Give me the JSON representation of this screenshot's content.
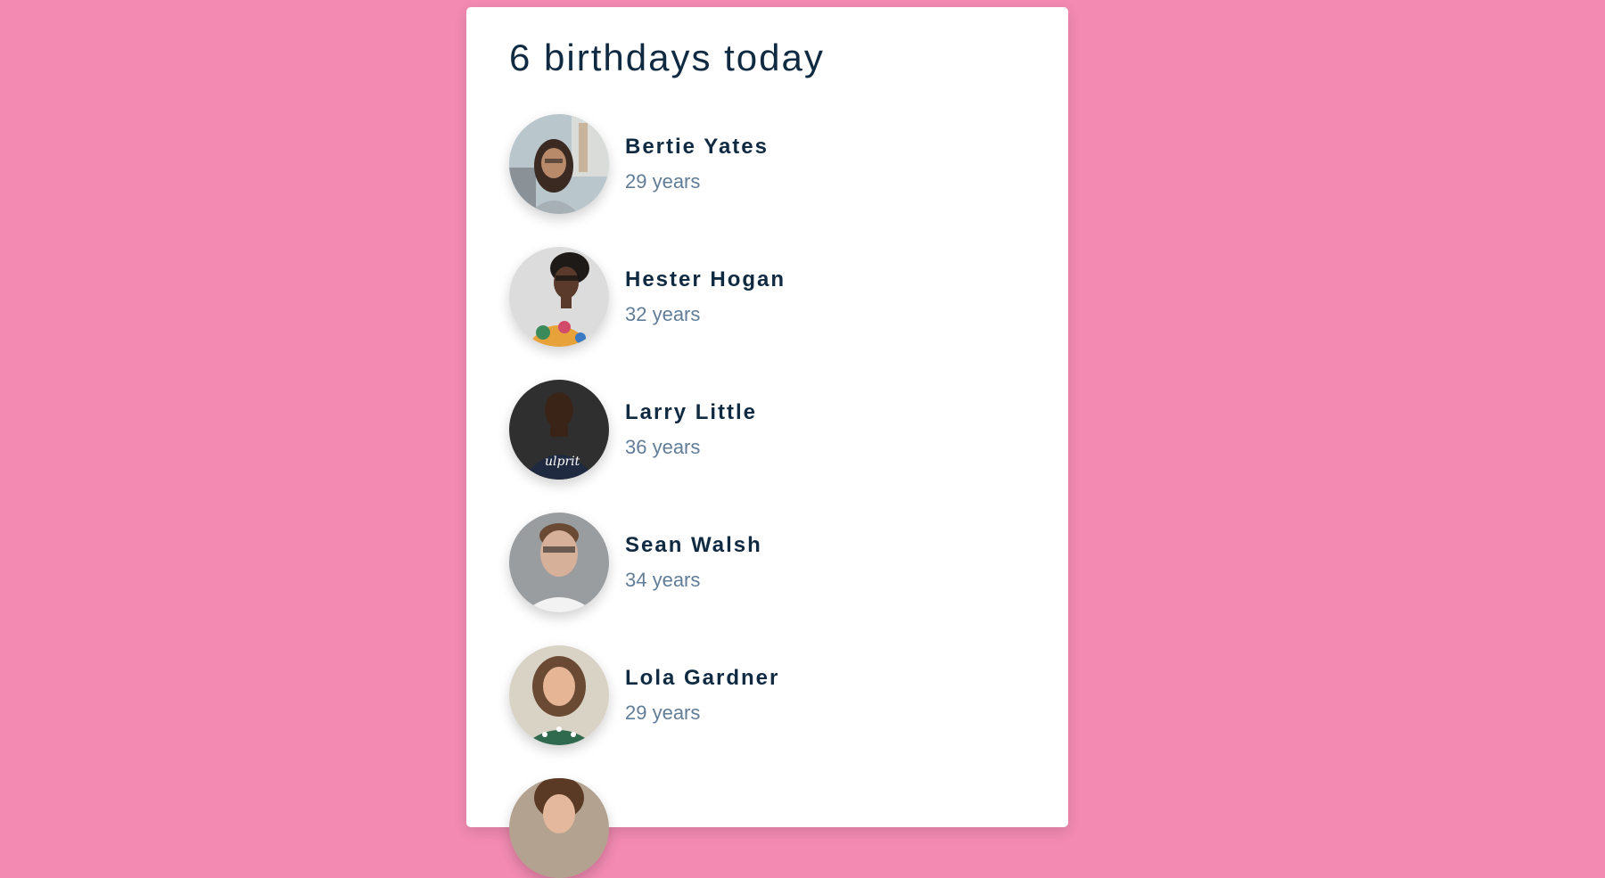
{
  "title": "6 birthdays today",
  "people": [
    {
      "name": "Bertie Yates",
      "age": "29 years",
      "avatar": "avatar-photo"
    },
    {
      "name": "Hester Hogan",
      "age": "32 years",
      "avatar": "avatar-photo"
    },
    {
      "name": "Larry Little",
      "age": "36 years",
      "avatar": "avatar-photo"
    },
    {
      "name": "Sean Walsh",
      "age": "34 years",
      "avatar": "avatar-photo"
    },
    {
      "name": "Lola Gardner",
      "age": "29 years",
      "avatar": "avatar-photo"
    },
    {
      "name": "",
      "age": "",
      "avatar": "avatar-photo"
    }
  ],
  "colors": {
    "background": "#f28ab2",
    "card": "#ffffff",
    "heading": "#102a42",
    "muted": "#617d98"
  }
}
